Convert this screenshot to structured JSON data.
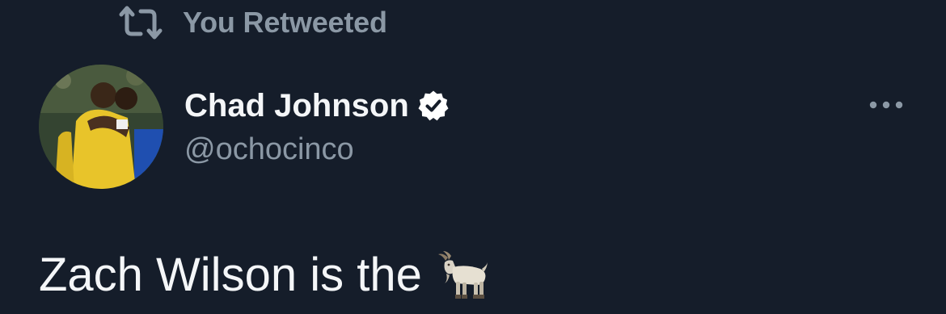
{
  "retweet": {
    "icon": "retweet-icon",
    "label": "You Retweeted"
  },
  "author": {
    "avatar_icon": "avatar",
    "name": "Chad Johnson",
    "verified_icon": "verified-badge-icon",
    "handle": "@ochocinco"
  },
  "actions": {
    "more_icon": "more-options-icon"
  },
  "tweet": {
    "text": "Zach Wilson is the",
    "emoji_icon": "goat-icon"
  },
  "colors": {
    "background": "#151d2a",
    "primary_text": "#f4f6f8",
    "secondary_text": "#8b98a5"
  }
}
